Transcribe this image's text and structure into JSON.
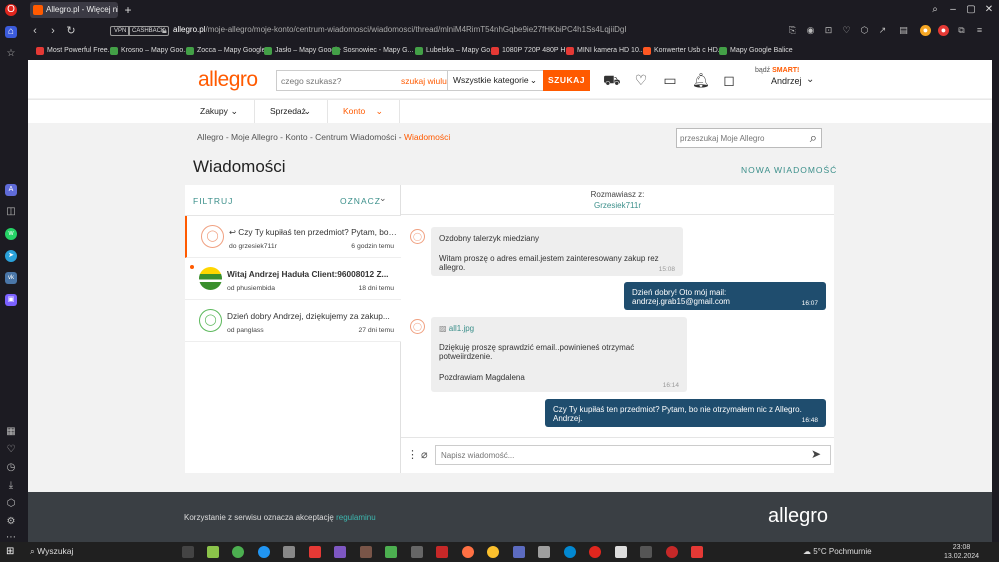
{
  "browser": {
    "tab_title": "Allegro.pl - Więcej niż aukcje",
    "vpn": "VPN",
    "cashback": "CASHBACK",
    "url_domain": "allegro.pl",
    "url_path": "/moje-allegro/moje-konto/centrum-wiadomosci/wiadomosci/thread/mlniM4RimT54nhGqbe9ie27fHKbiPC4h1Ss4LqjiiDgI",
    "bookmarks": [
      {
        "label": "Most Powerful Free...",
        "color": "#e53935"
      },
      {
        "label": "Krosno – Mapy Goo...",
        "color": "#43a047"
      },
      {
        "label": "Zocca – Mapy Google",
        "color": "#43a047"
      },
      {
        "label": "Jasło – Mapy Google",
        "color": "#43a047"
      },
      {
        "label": "Sosnowiec - Mapy G...",
        "color": "#43a047"
      },
      {
        "label": "Lubelska – Mapy Go...",
        "color": "#43a047"
      },
      {
        "label": "1080P 720P 480P H...",
        "color": "#e53935"
      },
      {
        "label": "MINI kamera HD 10...",
        "color": "#e53935"
      },
      {
        "label": "Konwerter Usb c HD...",
        "color": "#ff5722"
      },
      {
        "label": "Mapy Google Balice",
        "color": "#43a047"
      }
    ]
  },
  "header": {
    "logo": "allegro",
    "search_placeholder": "czego szukasz?",
    "search_wiki": "szukaj wiulu",
    "category": "Wszystkie kategorie",
    "search_button": "SZUKAJ",
    "smart_label": "bądź",
    "smart_brand": "SMART!",
    "user": "Andrzej"
  },
  "nav": {
    "items": [
      "Zakupy",
      "Sprzedaż",
      "Konto"
    ]
  },
  "breadcrumb": {
    "items": [
      "Allegro",
      "Moje Allegro",
      "Konto",
      "Centrum Wiadomości"
    ],
    "current": "Wiadomości",
    "sep": " - "
  },
  "messages_search_placeholder": "przeszukaj Moje Allegro",
  "page_title": "Wiadomości",
  "new_message": "NOWA WIADOMOŚĆ",
  "list": {
    "filter": "FILTRUJ",
    "mark": "OZNACZ",
    "conversations": [
      {
        "title": "Czy Ty kupiłaś ten przedmiot? Pytam, bo nie otrzymałem nic z Allegro.",
        "from": "do grzesiek711r",
        "time": "6 godzin temu"
      },
      {
        "title": "Witaj Andrzej Haduła Client:96008012 Z...",
        "from": "od phusiembida",
        "time": "18 dni temu"
      },
      {
        "title": "Dzień dobry Andrzej, dziękujemy za zakup...",
        "from": "od panglass",
        "time": "27 dni temu"
      }
    ]
  },
  "thread": {
    "with_label": "Rozmawiasz z:",
    "with_name": "Grzesiek711r",
    "messages": [
      {
        "title": "Ozdobny talerzyk miedziany",
        "body": "Witam proszę o adres email.jestem zainteresowany zakup rez allegro.",
        "time": "15:08"
      },
      {
        "body": "Dzień dobry! Oto mój mail: andrzej.grab15@gmail.com",
        "time": "16:07"
      },
      {
        "attachment": "all1.jpg",
        "body": "Dziękuję proszę sprawdzić email..powinieneś otrzymać potweiirdzenie.",
        "signature": "Pozdrawiam Magdalena",
        "time": "16:14"
      },
      {
        "body": "Czy Ty kupiłaś ten przedmiot? Pytam, bo nie otrzymałem nic z Allegro. Andrzej.",
        "time": "16:48"
      }
    ],
    "compose_placeholder": "Napisz wiadomość..."
  },
  "footer": {
    "text": "Korzystanie z serwisu oznacza akceptację",
    "link": "regulaminu",
    "logo": "allegro"
  },
  "taskbar": {
    "search": "Wyszukaj",
    "weather": "5°C  Pochmurnie",
    "time": "23:08",
    "date": "13.02.2024"
  }
}
